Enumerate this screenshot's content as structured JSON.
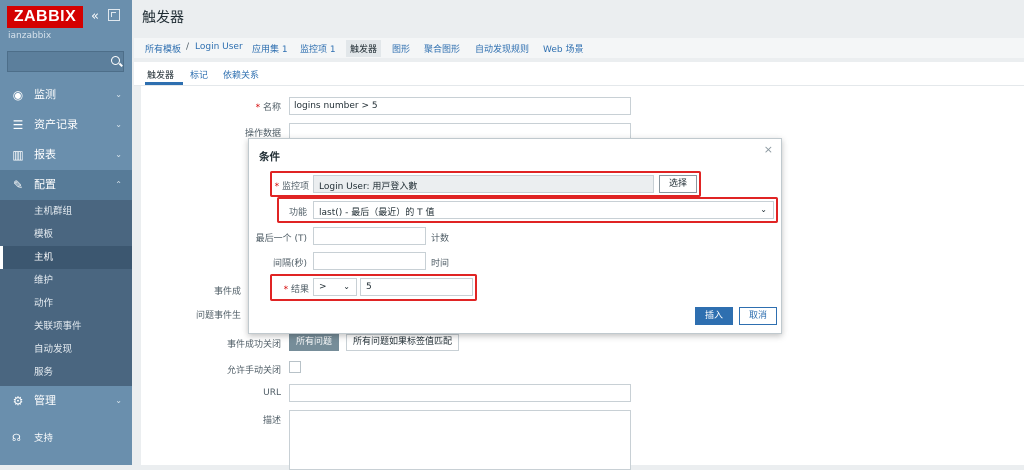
{
  "colors": {
    "sidebar": "#6a8fad",
    "brand": "#d40000",
    "accent": "#2e6fb0",
    "highlight": "#e02424"
  },
  "sidebar": {
    "logo": "ZABBIX",
    "server_name": "ianzabbix",
    "search_placeholder": "",
    "menu": [
      {
        "label": "监测",
        "icon": "eye-icon"
      },
      {
        "label": "资产记录",
        "icon": "list-icon"
      },
      {
        "label": "报表",
        "icon": "bar-chart-icon"
      },
      {
        "label": "配置",
        "icon": "wrench-icon"
      },
      {
        "label": "管理",
        "icon": "gear-icon"
      }
    ],
    "submenu": [
      "主机群组",
      "模板",
      "主机",
      "维护",
      "动作",
      "关联项事件",
      "自动发现",
      "服务"
    ],
    "support": "支持"
  },
  "page": {
    "title": "触发器",
    "breadcrumbs": [
      "所有模板",
      "/",
      "Login User",
      "应用集 1",
      "监控项 1",
      "触发器",
      "图形",
      "聚合图形",
      "自动发现规则",
      "Web 场景"
    ],
    "tabs": [
      "触发器",
      "标记",
      "依赖关系"
    ]
  },
  "form": {
    "name_label": "名称",
    "name_value": "logins number > 5",
    "opdata_label": "操作数据",
    "event_label": "事件成",
    "problem_event_label": "问题事件生",
    "ok_close_label": "事件成功关闭",
    "ok_close_options": [
      "所有问题",
      "所有问题如果标签值匹配"
    ],
    "manual_close_label": "允许手动关闭",
    "url_label": "URL",
    "desc_label": "描述"
  },
  "dialog": {
    "title": "条件",
    "close": "×",
    "item_label": "监控项",
    "item_value": "Login User: 用戸登入數",
    "select_button": "选择",
    "function_label": "功能",
    "function_value": "last() - 最后（最近）的 T 值",
    "last_label": "最后一个 (T)",
    "last_unit": "计数",
    "interval_label": "间隔(秒)",
    "interval_unit": "时间",
    "result_label": "结果",
    "operator": ">",
    "result_value": "5",
    "insert_button": "插入",
    "cancel_button": "取消"
  }
}
